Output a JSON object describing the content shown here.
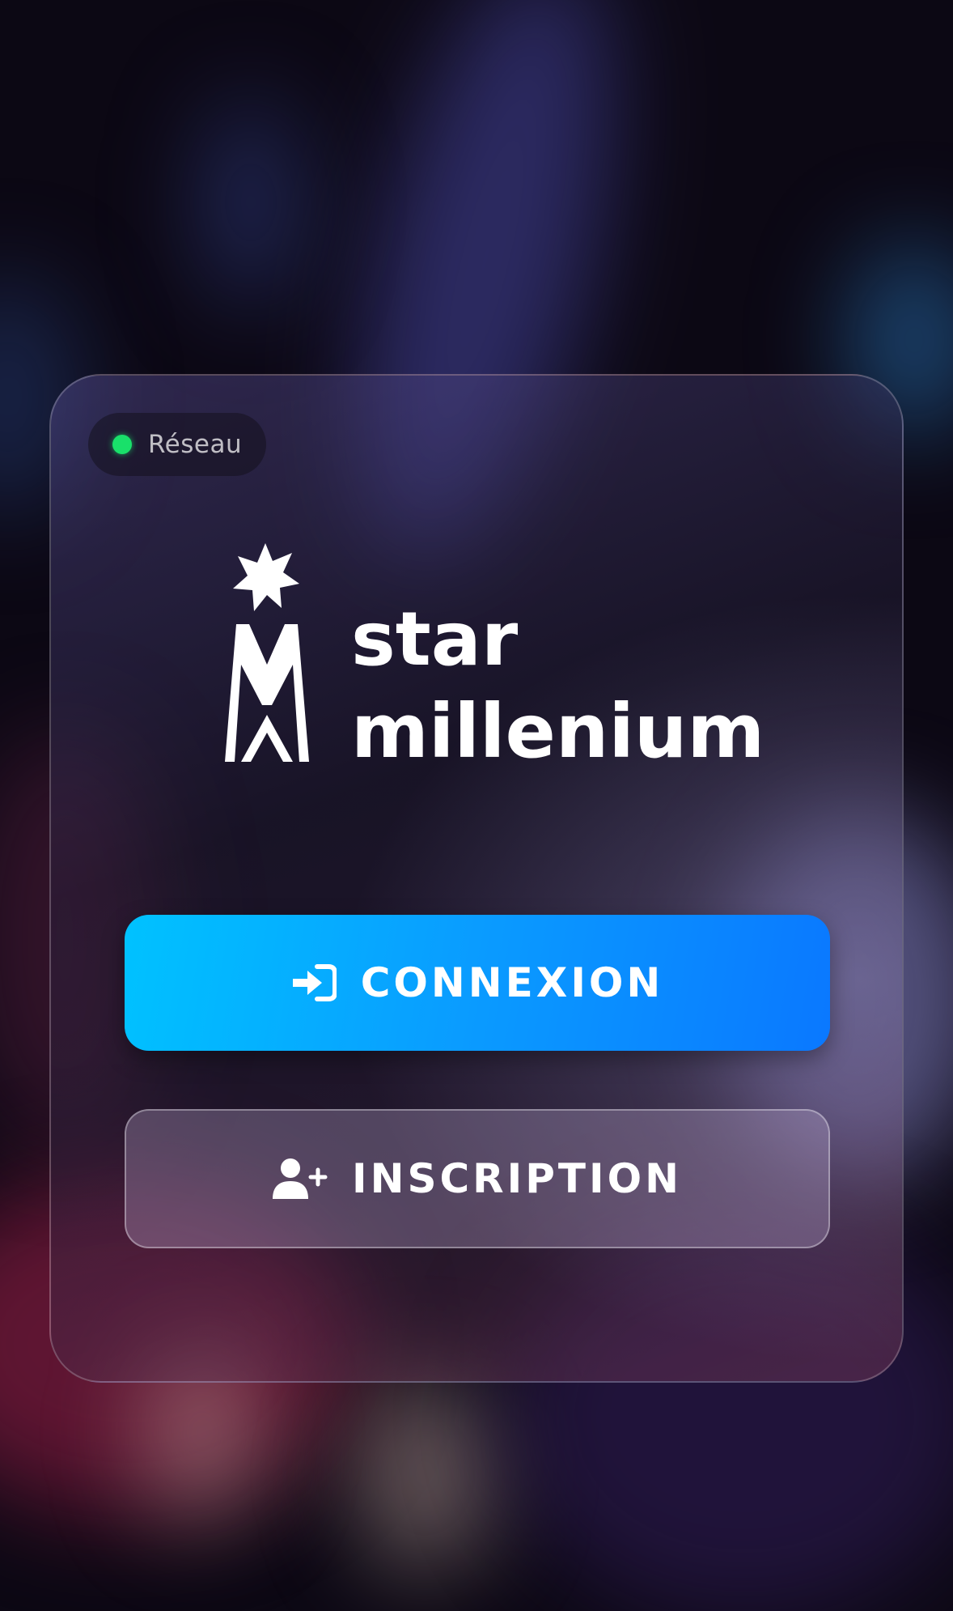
{
  "status": {
    "label": "Réseau",
    "color": "#19e06a"
  },
  "logo": {
    "word_top": "star",
    "word_bottom": "millenium",
    "mark_letter": "M"
  },
  "actions": {
    "login_label": "CONNEXION",
    "login_icon": "sign-in-icon",
    "register_label": "INSCRIPTION",
    "register_icon": "user-plus-icon"
  },
  "colors": {
    "login_gradient_start": "#00c2ff",
    "login_gradient_end": "#0a78ff"
  }
}
